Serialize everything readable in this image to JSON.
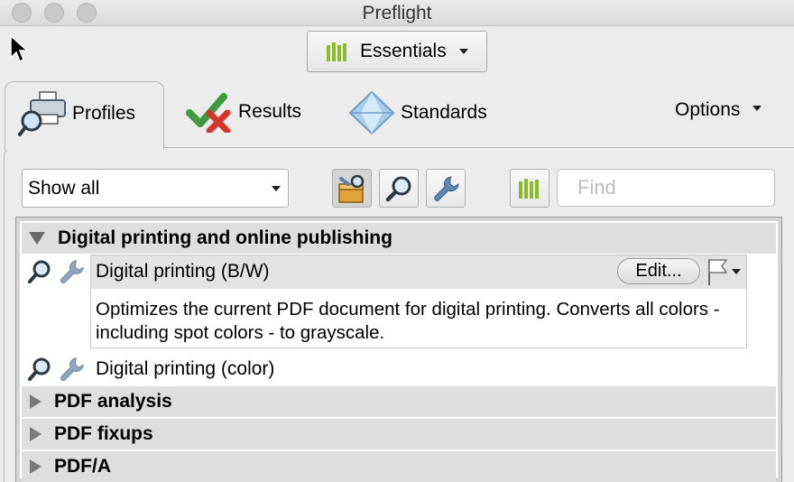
{
  "window": {
    "title": "Preflight"
  },
  "workspace": {
    "label": "Essentials",
    "accent_color": "#8bbb2b"
  },
  "tabs": [
    {
      "label": "Profiles",
      "icon": "printer-magnifier-icon",
      "active": true
    },
    {
      "label": "Results",
      "icon": "check-cross-icon",
      "active": false
    },
    {
      "label": "Standards",
      "icon": "diamond-icon",
      "active": false
    }
  ],
  "options": {
    "label": "Options"
  },
  "toolbar": {
    "filter_value": "Show all",
    "find_placeholder": "Find",
    "icons": [
      "toolbox-icon",
      "magnifier-icon",
      "wrench-icon",
      "library-icon"
    ]
  },
  "groups": [
    {
      "label": "Digital printing and online publishing",
      "expanded": true,
      "profiles": [
        {
          "name": "Digital printing (B/W)",
          "selected": true,
          "edit_label": "Edit...",
          "description": "Optimizes the current PDF document for digital printing. Converts all colors - including spot colors - to grayscale."
        },
        {
          "name": "Digital printing (color)",
          "selected": false
        }
      ]
    },
    {
      "label": "PDF analysis",
      "expanded": false
    },
    {
      "label": "PDF fixups",
      "expanded": false
    },
    {
      "label": "PDF/A",
      "expanded": false
    }
  ]
}
